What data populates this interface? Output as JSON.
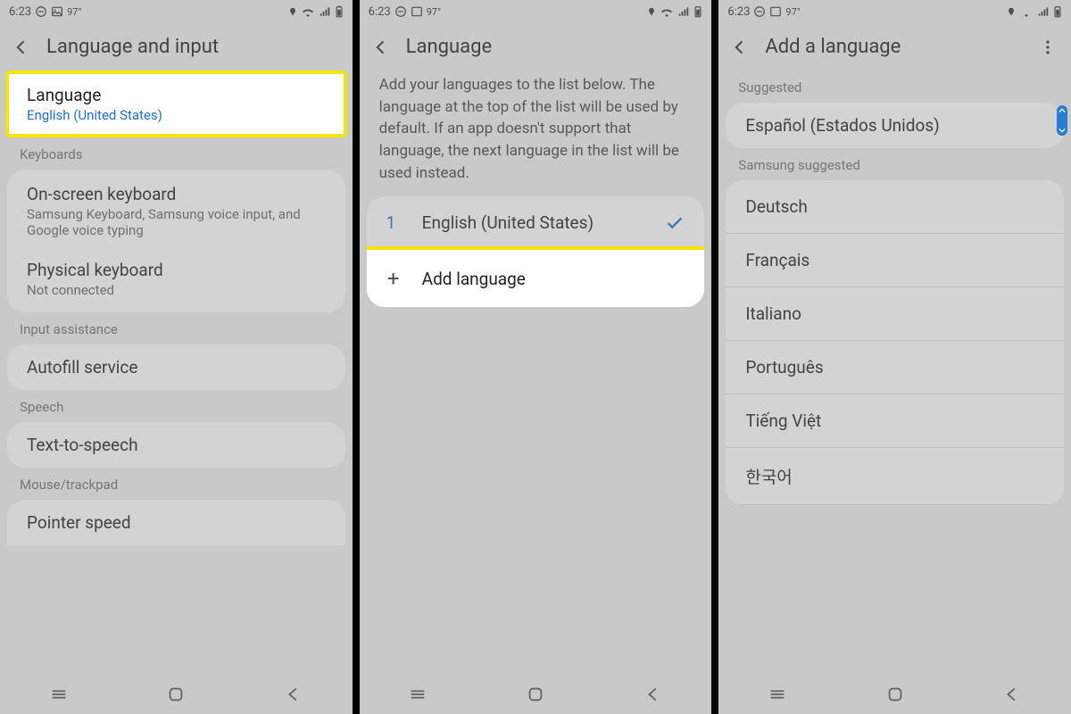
{
  "status": {
    "time": "6:23",
    "temp": "97°"
  },
  "screens": [
    {
      "title": "Language and input",
      "language": {
        "title": "Language",
        "value": "English (United States)"
      },
      "s_keyboards": "Keyboards",
      "onscreen": {
        "title": "On-screen keyboard",
        "sub": "Samsung Keyboard, Samsung voice input, and Google voice typing"
      },
      "physical": {
        "title": "Physical keyboard",
        "sub": "Not connected"
      },
      "s_input": "Input assistance",
      "autofill": "Autofill service",
      "s_speech": "Speech",
      "tts": "Text-to-speech",
      "s_mouse": "Mouse/trackpad",
      "pointer": "Pointer speed"
    },
    {
      "title": "Language",
      "desc": "Add your languages to the list below. The language at the top of the list will be used by default. If an app doesn't support that language, the next language in the list will be used instead.",
      "num": "1",
      "english": "English (United States)",
      "add": "Add language"
    },
    {
      "title": "Add a language",
      "s_suggested": "Suggested",
      "espanol": "Español (Estados Unidos)",
      "s_samsung": "Samsung suggested",
      "langs": [
        "Deutsch",
        "Français",
        "Italiano",
        "Português",
        "Tiếng Việt",
        "한국어"
      ]
    }
  ]
}
